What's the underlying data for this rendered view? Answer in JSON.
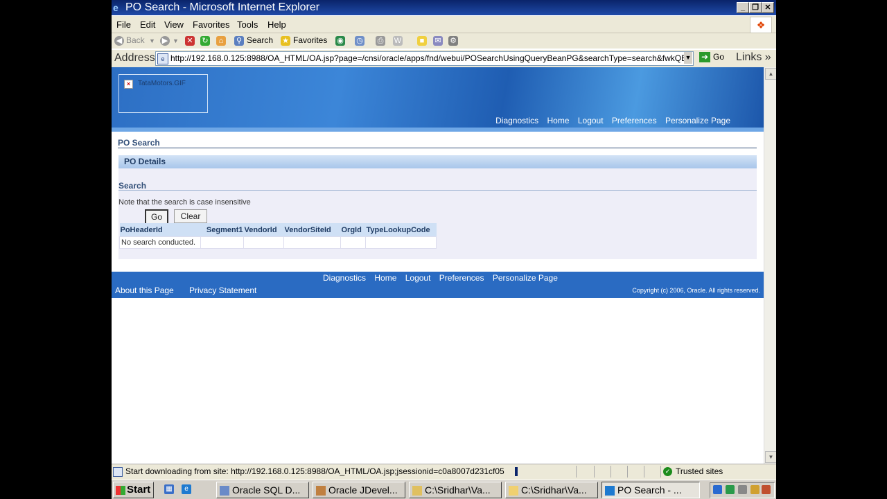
{
  "window": {
    "title": "PO Search - Microsoft Internet Explorer",
    "ie_icon": "ie-icon"
  },
  "menu": {
    "items": [
      "File",
      "Edit",
      "View",
      "Favorites",
      "Tools",
      "Help"
    ]
  },
  "toolbar": {
    "back": "Back",
    "search": "Search",
    "favorites": "Favorites"
  },
  "address": {
    "label": "Address",
    "url": "http://192.168.0.125:8988/OA_HTML/OA.jsp?page=/cnsi/oracle/apps/fnd/webui/POSearchUsingQueryBeanPG&searchType=search&fwkQB",
    "go": "Go",
    "links": "Links"
  },
  "header": {
    "logo_alt": "TataMotors.GIF",
    "global_nav": [
      "Diagnostics",
      "Home",
      "Logout",
      "Preferences",
      "Personalize Page"
    ]
  },
  "page": {
    "title": "PO Search",
    "section": "PO Details",
    "search_header": "Search",
    "note": "Note that the search is case insensitive",
    "go_label": "Go",
    "clear_label": "Clear",
    "columns": [
      "PoHeaderId",
      "Segment1",
      "VendorId",
      "VendorSiteId",
      "OrgId",
      "TypeLookupCode"
    ],
    "empty_message": "No search conducted."
  },
  "footer": {
    "nav": [
      "Diagnostics",
      "Home",
      "Logout",
      "Preferences",
      "Personalize Page"
    ],
    "about": "About this Page",
    "privacy": "Privacy Statement",
    "copyright": "Copyright (c) 2006, Oracle. All rights reserved."
  },
  "status": {
    "text": "Start downloading from site: http://192.168.0.125:8988/OA_HTML/OA.jsp;jsessionid=c0a8007d231cf05",
    "zone": "Trusted sites"
  },
  "taskbar": {
    "start": "Start",
    "tasks": [
      "Oracle SQL D...",
      "Oracle JDevel...",
      "C:\\Sridhar\\Va...",
      "C:\\Sridhar\\Va...",
      "PO Search - ..."
    ]
  }
}
